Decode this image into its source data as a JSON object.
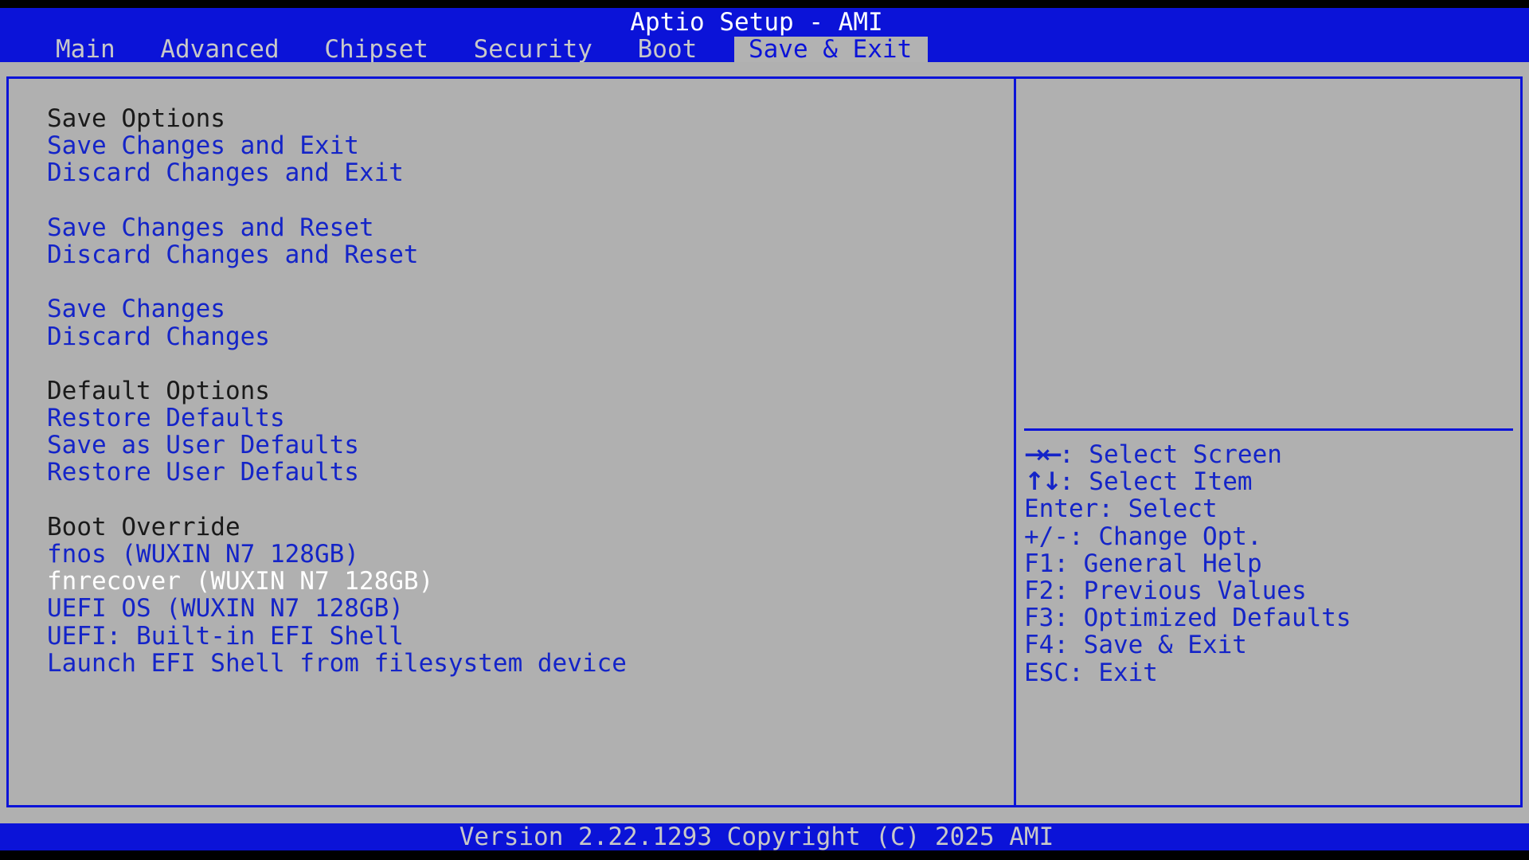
{
  "header": {
    "title": "Aptio Setup - AMI",
    "tabs": [
      {
        "label": "Main"
      },
      {
        "label": "Advanced"
      },
      {
        "label": "Chipset"
      },
      {
        "label": "Security"
      },
      {
        "label": "Boot"
      },
      {
        "label": "Save & Exit",
        "active": true
      }
    ]
  },
  "menu": {
    "save_options": {
      "heading": "Save Options",
      "items": [
        "Save Changes and Exit",
        "Discard Changes and Exit",
        "Save Changes and Reset",
        "Discard Changes and Reset",
        "Save Changes",
        "Discard Changes"
      ]
    },
    "default_options": {
      "heading": "Default Options",
      "items": [
        "Restore Defaults",
        "Save as User Defaults",
        "Restore User Defaults"
      ]
    },
    "boot_override": {
      "heading": "Boot Override",
      "items": [
        "fnos (WUXIN N7 128GB)",
        "fnrecover (WUXIN N7 128GB)",
        "UEFI OS (WUXIN N7 128GB)",
        "UEFI: Built-in EFI Shell",
        "Launch EFI Shell from filesystem device"
      ],
      "selected_index": 1
    }
  },
  "help_panel": {
    "description": "",
    "keys": [
      {
        "glyph": "→←",
        "text": ": Select Screen"
      },
      {
        "glyph": "↑↓",
        "text": ": Select Item"
      },
      {
        "glyph": "",
        "text": "Enter: Select"
      },
      {
        "glyph": "",
        "text": "+/-: Change Opt."
      },
      {
        "glyph": "",
        "text": "F1: General Help"
      },
      {
        "glyph": "",
        "text": "F2: Previous Values"
      },
      {
        "glyph": "",
        "text": "F3: Optimized Defaults"
      },
      {
        "glyph": "",
        "text": "F4: Save & Exit"
      },
      {
        "glyph": "",
        "text": "ESC: Exit"
      }
    ]
  },
  "footer": {
    "version": "Version 2.22.1293 Copyright (C) 2025 AMI"
  },
  "colors": {
    "bios_blue": "#0b13d8",
    "panel_gray": "#b0b0b0",
    "item_blue": "#1424c8",
    "selected_white": "#ffffff"
  }
}
